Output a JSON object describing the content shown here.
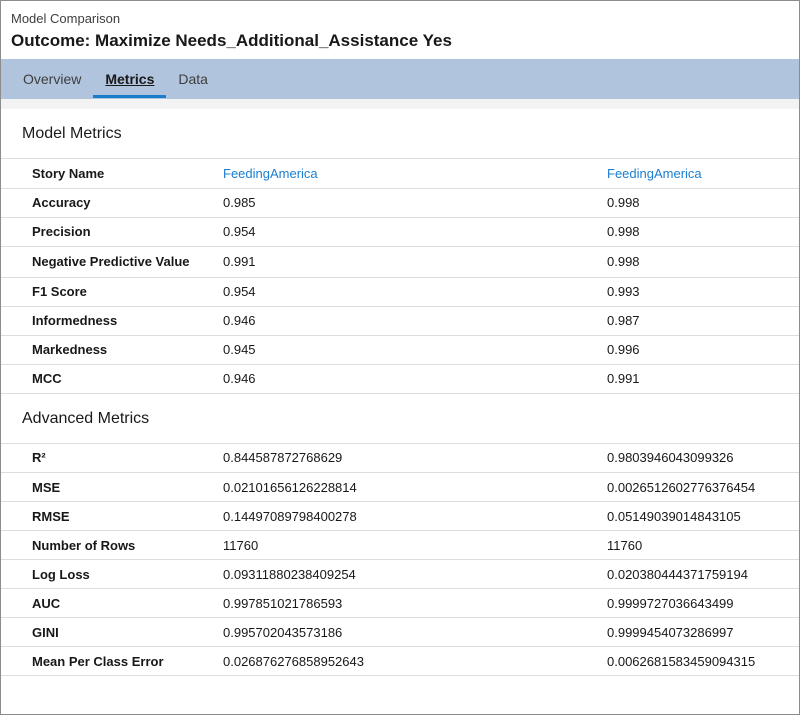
{
  "header": {
    "subtitle": "Model Comparison",
    "title": "Outcome: Maximize Needs_Additional_Assistance Yes"
  },
  "tabs": [
    {
      "label": "Overview"
    },
    {
      "label": "Metrics"
    },
    {
      "label": "Data"
    }
  ],
  "active_tab": "Metrics",
  "model_metrics": {
    "title": "Model Metrics",
    "story_row": {
      "label": "Story Name",
      "v1": "FeedingAmerica",
      "v2": "FeedingAmerica"
    },
    "rows": [
      {
        "label": "Accuracy",
        "v1": "0.985",
        "v2": "0.998"
      },
      {
        "label": "Precision",
        "v1": "0.954",
        "v2": "0.998"
      },
      {
        "label": "Negative Predictive Value",
        "v1": "0.991",
        "v2": "0.998"
      },
      {
        "label": "F1 Score",
        "v1": "0.954",
        "v2": "0.993"
      },
      {
        "label": "Informedness",
        "v1": "0.946",
        "v2": "0.987"
      },
      {
        "label": "Markedness",
        "v1": "0.945",
        "v2": "0.996"
      },
      {
        "label": "MCC",
        "v1": "0.946",
        "v2": "0.991"
      }
    ]
  },
  "advanced_metrics": {
    "title": "Advanced Metrics",
    "rows": [
      {
        "label": "R²",
        "v1": "0.844587872768629",
        "v2": "0.9803946043099326"
      },
      {
        "label": "MSE",
        "v1": "0.02101656126228814",
        "v2": "0.0026512602776376454"
      },
      {
        "label": "RMSE",
        "v1": "0.14497089798400278",
        "v2": "0.05149039014843105"
      },
      {
        "label": "Number of Rows",
        "v1": "11760",
        "v2": "11760"
      },
      {
        "label": "Log Loss",
        "v1": "0.09311880238409254",
        "v2": "0.020380444371759194"
      },
      {
        "label": "AUC",
        "v1": "0.997851021786593",
        "v2": "0.9999727036643499"
      },
      {
        "label": "GINI",
        "v1": "0.995702043573186",
        "v2": "0.9999454073286997"
      },
      {
        "label": "Mean Per Class Error",
        "v1": "0.026876276858952643",
        "v2": "0.0062681583459094315"
      }
    ]
  },
  "colors": {
    "tabbar": "#b0c4de",
    "link": "#1a7ed2",
    "active_tab_underline": "#1b7ccc"
  }
}
